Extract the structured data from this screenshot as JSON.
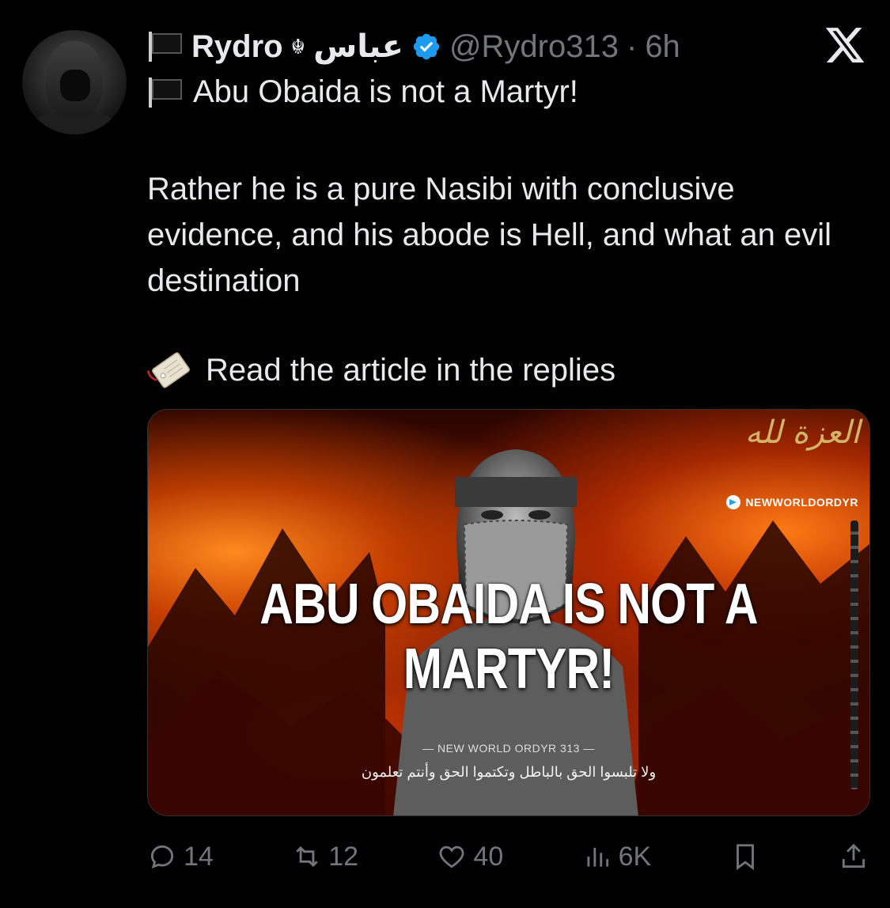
{
  "tweet": {
    "author": {
      "name": "Rydro",
      "emblem": "☬",
      "arabic_name": "عباس",
      "handle": "@Rydro313",
      "separator": "·",
      "time": "6h",
      "verified": true,
      "verified_color": "#1d9bf0"
    },
    "first_line": "Abu Obaida is not a Martyr!",
    "paragraph": "Rather he is a pure Nasibi with conclusive evidence, and his abode is Hell, and what an evil destination",
    "read_line": "Read the article in the replies",
    "icons": {
      "flag": "black-flag",
      "read": "bookmark-tabs",
      "platform_logo": "x-logo"
    },
    "media": {
      "headline": "ABU OBAIDA IS NOT A MARTYR!",
      "arabic_top": "العزة لله",
      "channel": "NEWWORLDORDYR",
      "caption": "— NEW WORLD ORDYR 313 —",
      "verse": "ولا تلبسوا الحق بالباطل وتكتموا الحق وأنتم تعلمون"
    },
    "stats": {
      "replies": "14",
      "reposts": "12",
      "likes": "40",
      "views": "6K"
    }
  }
}
